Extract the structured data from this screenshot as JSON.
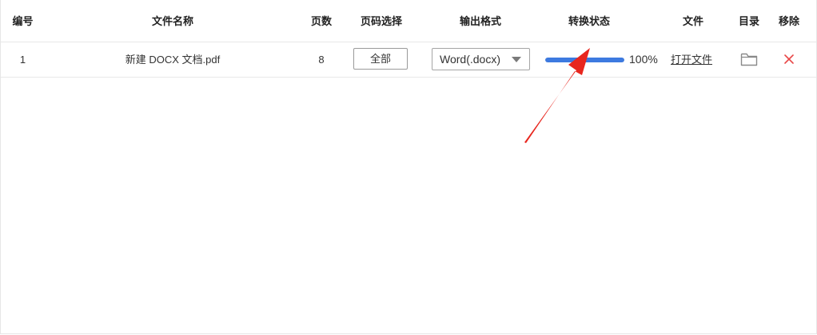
{
  "header": {
    "col_index": "编号",
    "col_filename": "文件名称",
    "col_pages": "页数",
    "col_page_select": "页码选择",
    "col_output_format": "输出格式",
    "col_status": "转换状态",
    "col_file": "文件",
    "col_directory": "目录",
    "col_remove": "移除"
  },
  "rows": [
    {
      "index": "1",
      "filename": "新建 DOCX 文档.pdf",
      "pages": "8",
      "page_select_label": "全部",
      "output_format": "Word(.docx)",
      "progress": 1.0,
      "progress_text": "100%",
      "open_file_label": "打开文件"
    }
  ],
  "colors": {
    "progress": "#3d7ae0",
    "remove": "#e84848",
    "annotation_arrow": "#e8261e"
  },
  "icons": {
    "directory": "folder-icon",
    "remove": "close-icon",
    "select": "chevron-down-icon"
  }
}
